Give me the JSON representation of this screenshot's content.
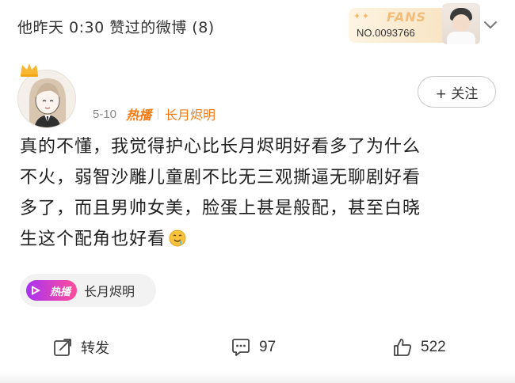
{
  "header": {
    "title": "他昨天 0:30 赞过的微博 (8)",
    "fans_badge": {
      "word": "FANS",
      "number": "NO.0093766"
    }
  },
  "post": {
    "date": "5-10",
    "hot_tag": "热播",
    "topic": "长月烬明",
    "follow_label": "+ 关注",
    "body_lines": [
      "真的不懂，我觉得护心比长月烬明好看多了为什么",
      "不火，弱智沙雕儿童剧不比无三观撕逼无聊剧好看",
      "多了，而且男帅女美，脸蛋上甚是般配，甚至白晓",
      "生这个配角也好看"
    ],
    "emoji": "drooling-face-emoji",
    "topic_chip": {
      "hot": "热播",
      "label": "长月烬明"
    }
  },
  "actions": {
    "repost": {
      "label": "转发",
      "icon": "repost-icon"
    },
    "comment": {
      "count": "97",
      "icon": "comment-icon"
    },
    "like": {
      "count": "522",
      "icon": "thumbs-up-icon"
    }
  },
  "colors": {
    "accent_orange": "#f57a13",
    "chip_gradient_start": "#a832f2",
    "chip_gradient_end": "#ff4d9a"
  }
}
